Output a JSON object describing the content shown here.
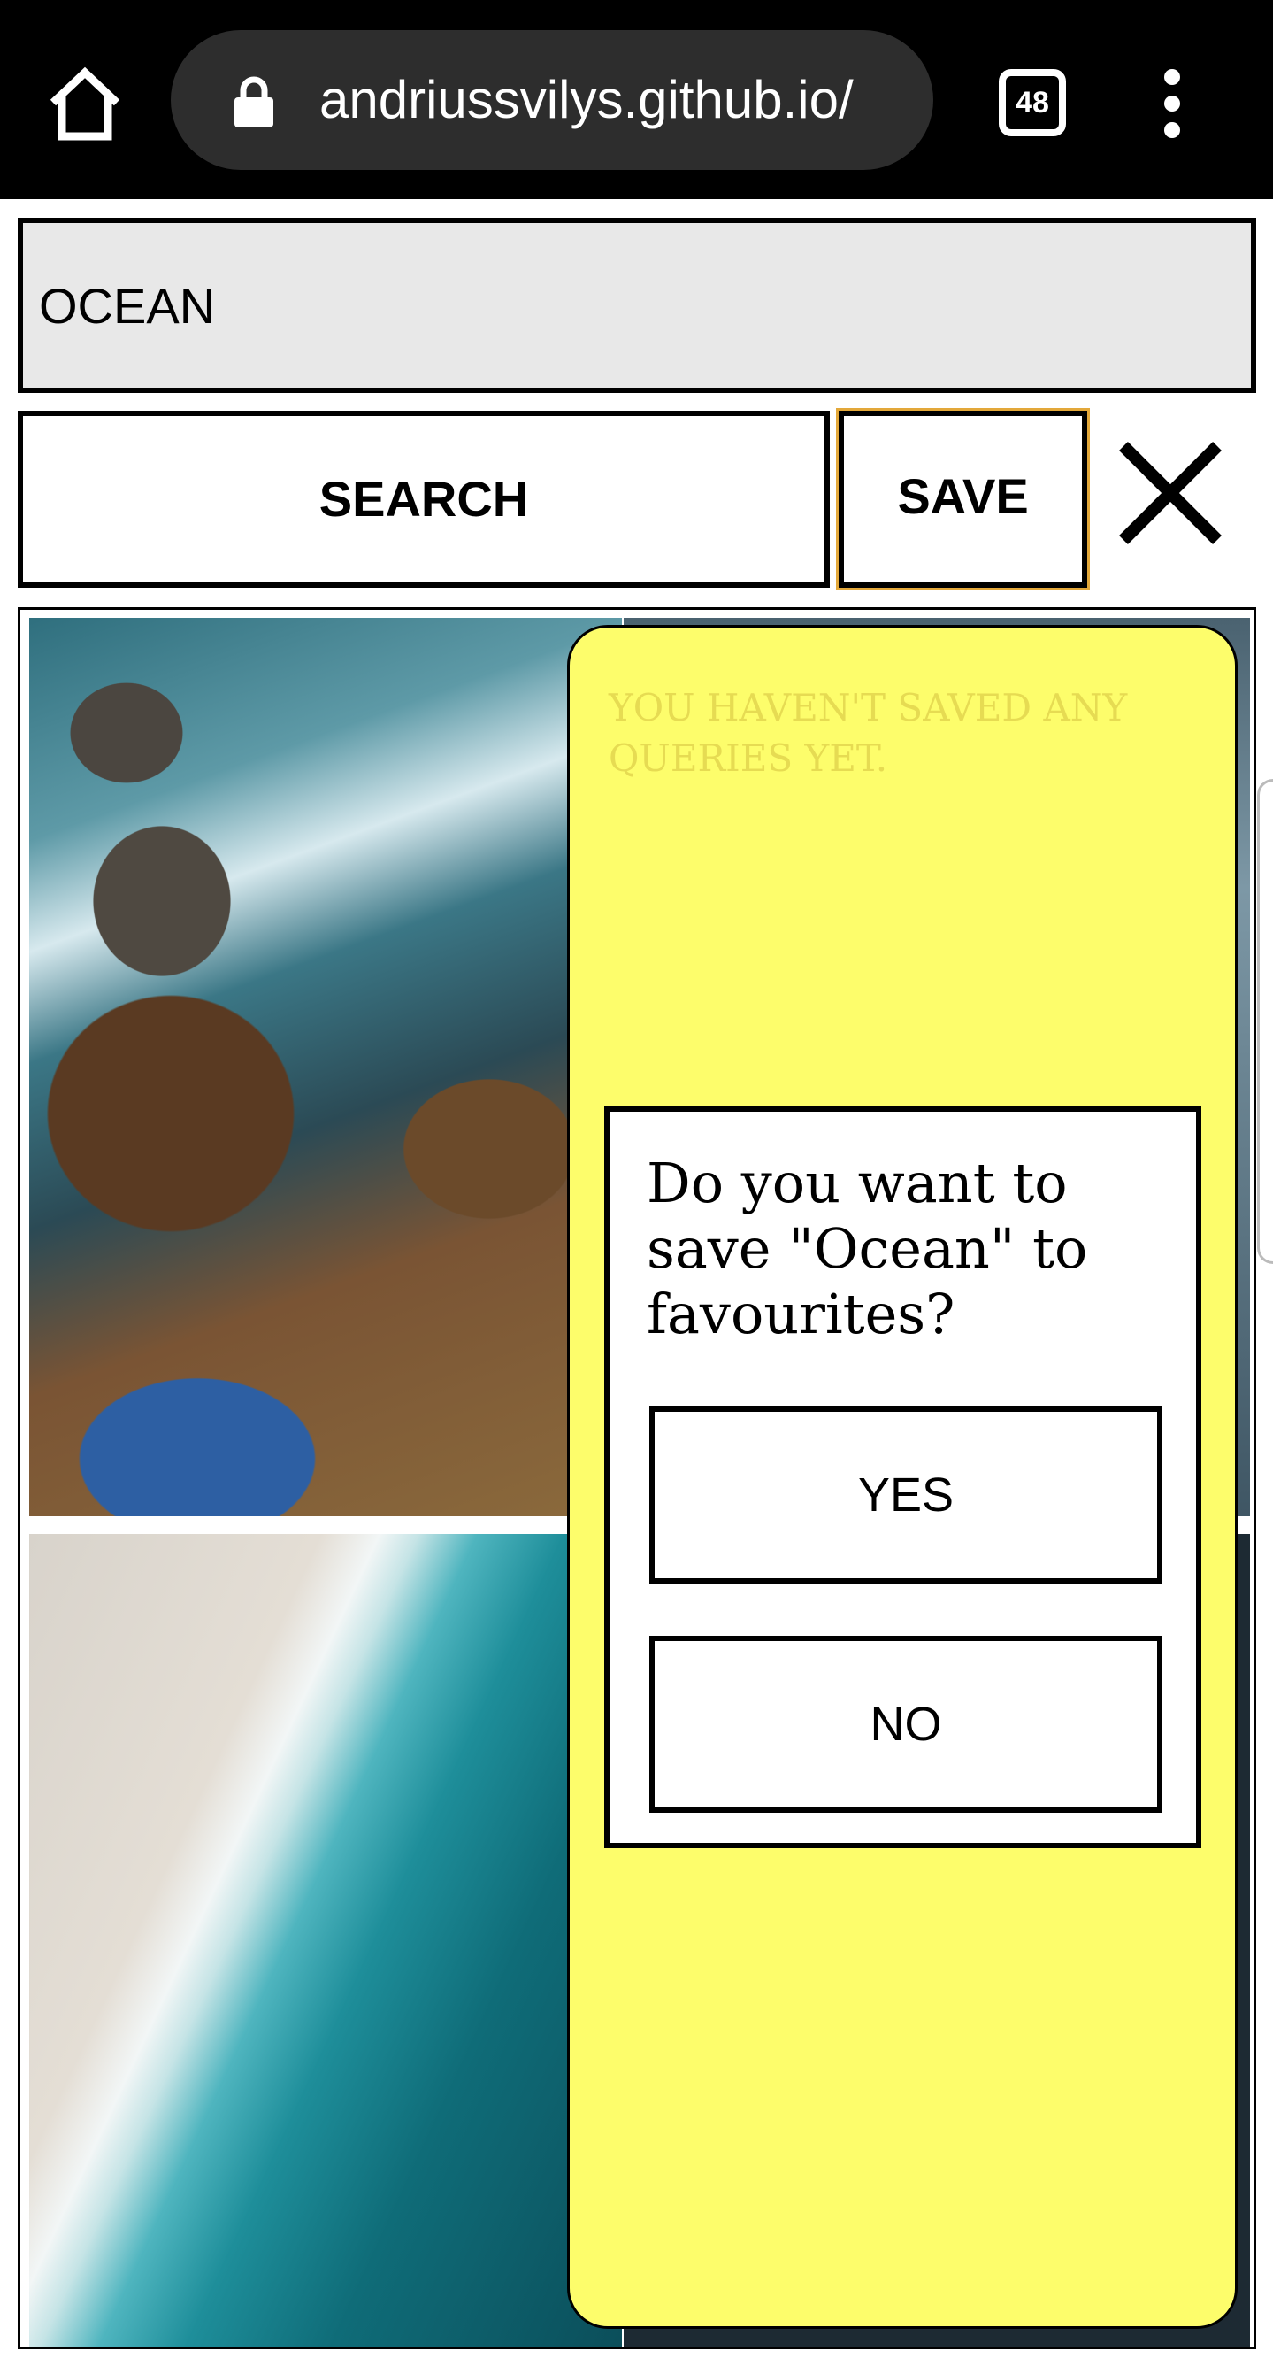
{
  "browser": {
    "url": "andriussvilys.github.io/",
    "tab_count": "48",
    "icons": {
      "home": "home-icon",
      "lock": "lock-icon",
      "menu": "more-vert-icon"
    }
  },
  "search": {
    "value": "OCEAN",
    "search_label": "SEARCH",
    "save_label": "SAVE",
    "close_icon": "close-icon",
    "save_outline_color": "#e3a83a"
  },
  "favourites": {
    "empty_message": "YOU HAVEN'T SAVED ANY QUERIES YET.",
    "panel_color": "#fdfd6b",
    "empty_text_color": "#e6db52"
  },
  "confirm_dialog": {
    "question": "Do you want to save \"Ocean\" to favourites?",
    "yes_label": "YES",
    "no_label": "NO"
  }
}
